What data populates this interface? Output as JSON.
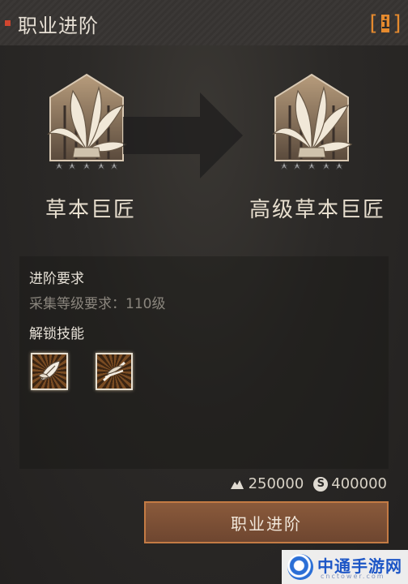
{
  "header": {
    "title": "职业进阶",
    "info_icon": "info-icon"
  },
  "profession": {
    "current": {
      "name": "草本巨匠",
      "stars": 5,
      "icon": "herb-badge-icon"
    },
    "next": {
      "name": "高级草本巨匠",
      "stars": 5,
      "icon": "herb-badge-icon"
    },
    "arrow_icon": "right-arrow-icon"
  },
  "requirements": {
    "title": "进阶要求",
    "gather_level": "采集等级要求：110级"
  },
  "skills": {
    "title": "解锁技能",
    "items": [
      {
        "icon": "herb-leaf-skill-icon"
      },
      {
        "icon": "herb-stalk-skill-icon"
      }
    ]
  },
  "cost": {
    "ore_icon": "ore-icon",
    "ore_amount": "250000",
    "coin_icon": "silver-coin-icon",
    "coin_symbol": "S",
    "coin_amount": "400000"
  },
  "action": {
    "advance_label": "职业进阶"
  },
  "watermark": {
    "text": "中通手游网",
    "sub": "cnctower.com"
  },
  "colors": {
    "accent": "#e58a2e",
    "button_border": "#c47b44",
    "title_mark": "#d0462f"
  }
}
